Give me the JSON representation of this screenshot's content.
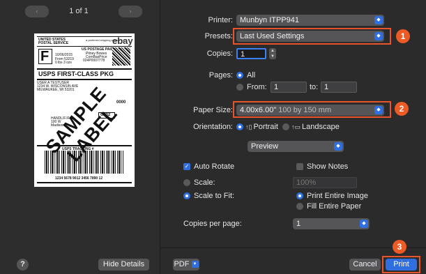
{
  "preview": {
    "prev_label": "‹",
    "next_label": "›",
    "page_counter": "1 of 1",
    "label": {
      "carrier_line1": "UNITED STATES",
      "carrier_line2": "POSTAL SERVICE",
      "ebay_tagline": "a preferred shipping service on",
      "ebay_logo": "ebay",
      "class_letter": "F",
      "postage_title": "US POSTAGE PAID",
      "postage_lines": [
        "Pitney Bowes",
        "ComBasPrice",
        "024P0007778"
      ],
      "ship_date": "10/06/2015",
      "from_zip": "From 53219",
      "weight": "0 lbs 3 ozs",
      "service": "USPS FIRST-CLASS PKG",
      "sender_lines": [
        "USER A TESTUSER",
        "1234 W. WISCONSIN AVE",
        "MILWAUKEE, WI 53201"
      ],
      "code_0000": "0000",
      "code_c002": "C002",
      "recipient_lines": [
        "HANDLIF.IF.A",
        "100 W",
        "Madison"
      ],
      "tracking_title": "USPS TRACKING #",
      "tracking_number": "1234 5678 9012 3456 7890 12",
      "watermark": "SAMPLE LABEL"
    },
    "help_label": "?",
    "hide_details_label": "Hide Details"
  },
  "settings": {
    "printer_label": "Printer:",
    "printer_value": "Munbyn ITPP941",
    "presets_label": "Presets:",
    "presets_value": "Last Used Settings",
    "copies_label": "Copies:",
    "copies_value": "1",
    "pages_label": "Pages:",
    "pages_all": "All",
    "pages_from": "From:",
    "pages_from_value": "1",
    "pages_to": "to:",
    "pages_to_value": "1",
    "paper_size_label": "Paper Size:",
    "paper_size_value": "4.00x6.00\"",
    "paper_size_detail": " 100 by 150 mm",
    "orientation_label": "Orientation:",
    "orientation_portrait": "Portrait",
    "orientation_landscape": "Landscape",
    "section_value": "Preview",
    "auto_rotate": "Auto Rotate",
    "show_notes": "Show Notes",
    "scale": "Scale:",
    "scale_value": "100%",
    "scale_to_fit": "Scale to Fit:",
    "print_entire_image": "Print Entire Image",
    "fill_entire_paper": "Fill Entire Paper",
    "copies_per_page_label": "Copies per page:",
    "copies_per_page_value": "1"
  },
  "footer": {
    "pdf_label": "PDF",
    "cancel_label": "Cancel",
    "print_label": "Print"
  },
  "annotations": {
    "badge1": "1",
    "badge2": "2",
    "badge3": "3"
  },
  "colors": {
    "accent": "#2f6fe0",
    "annotation": "#ec5a25"
  }
}
